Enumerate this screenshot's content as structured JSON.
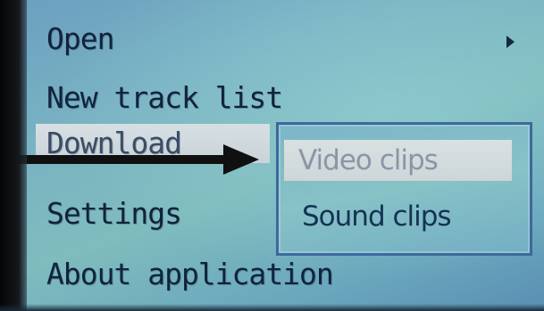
{
  "menu": {
    "items": [
      {
        "label": "Open",
        "has_submenu": true
      },
      {
        "label": "New track list"
      },
      {
        "label": "Download",
        "selected": true
      },
      {
        "label": "Settings"
      },
      {
        "label": "About application"
      }
    ]
  },
  "submenu": {
    "parent": "Download",
    "items": [
      {
        "label": "Video clips",
        "selected": true
      },
      {
        "label": "Sound clips"
      }
    ]
  },
  "colors": {
    "screen_background": "#79b2c2",
    "text": "#11233c",
    "highlight": "#d7dfe3",
    "submenu_border": "#3d6a9c",
    "annotation_arrow": "#101010"
  },
  "icons": {
    "submenu_indicator": "triangle-right-icon",
    "annotation": "arrow-right-icon"
  }
}
